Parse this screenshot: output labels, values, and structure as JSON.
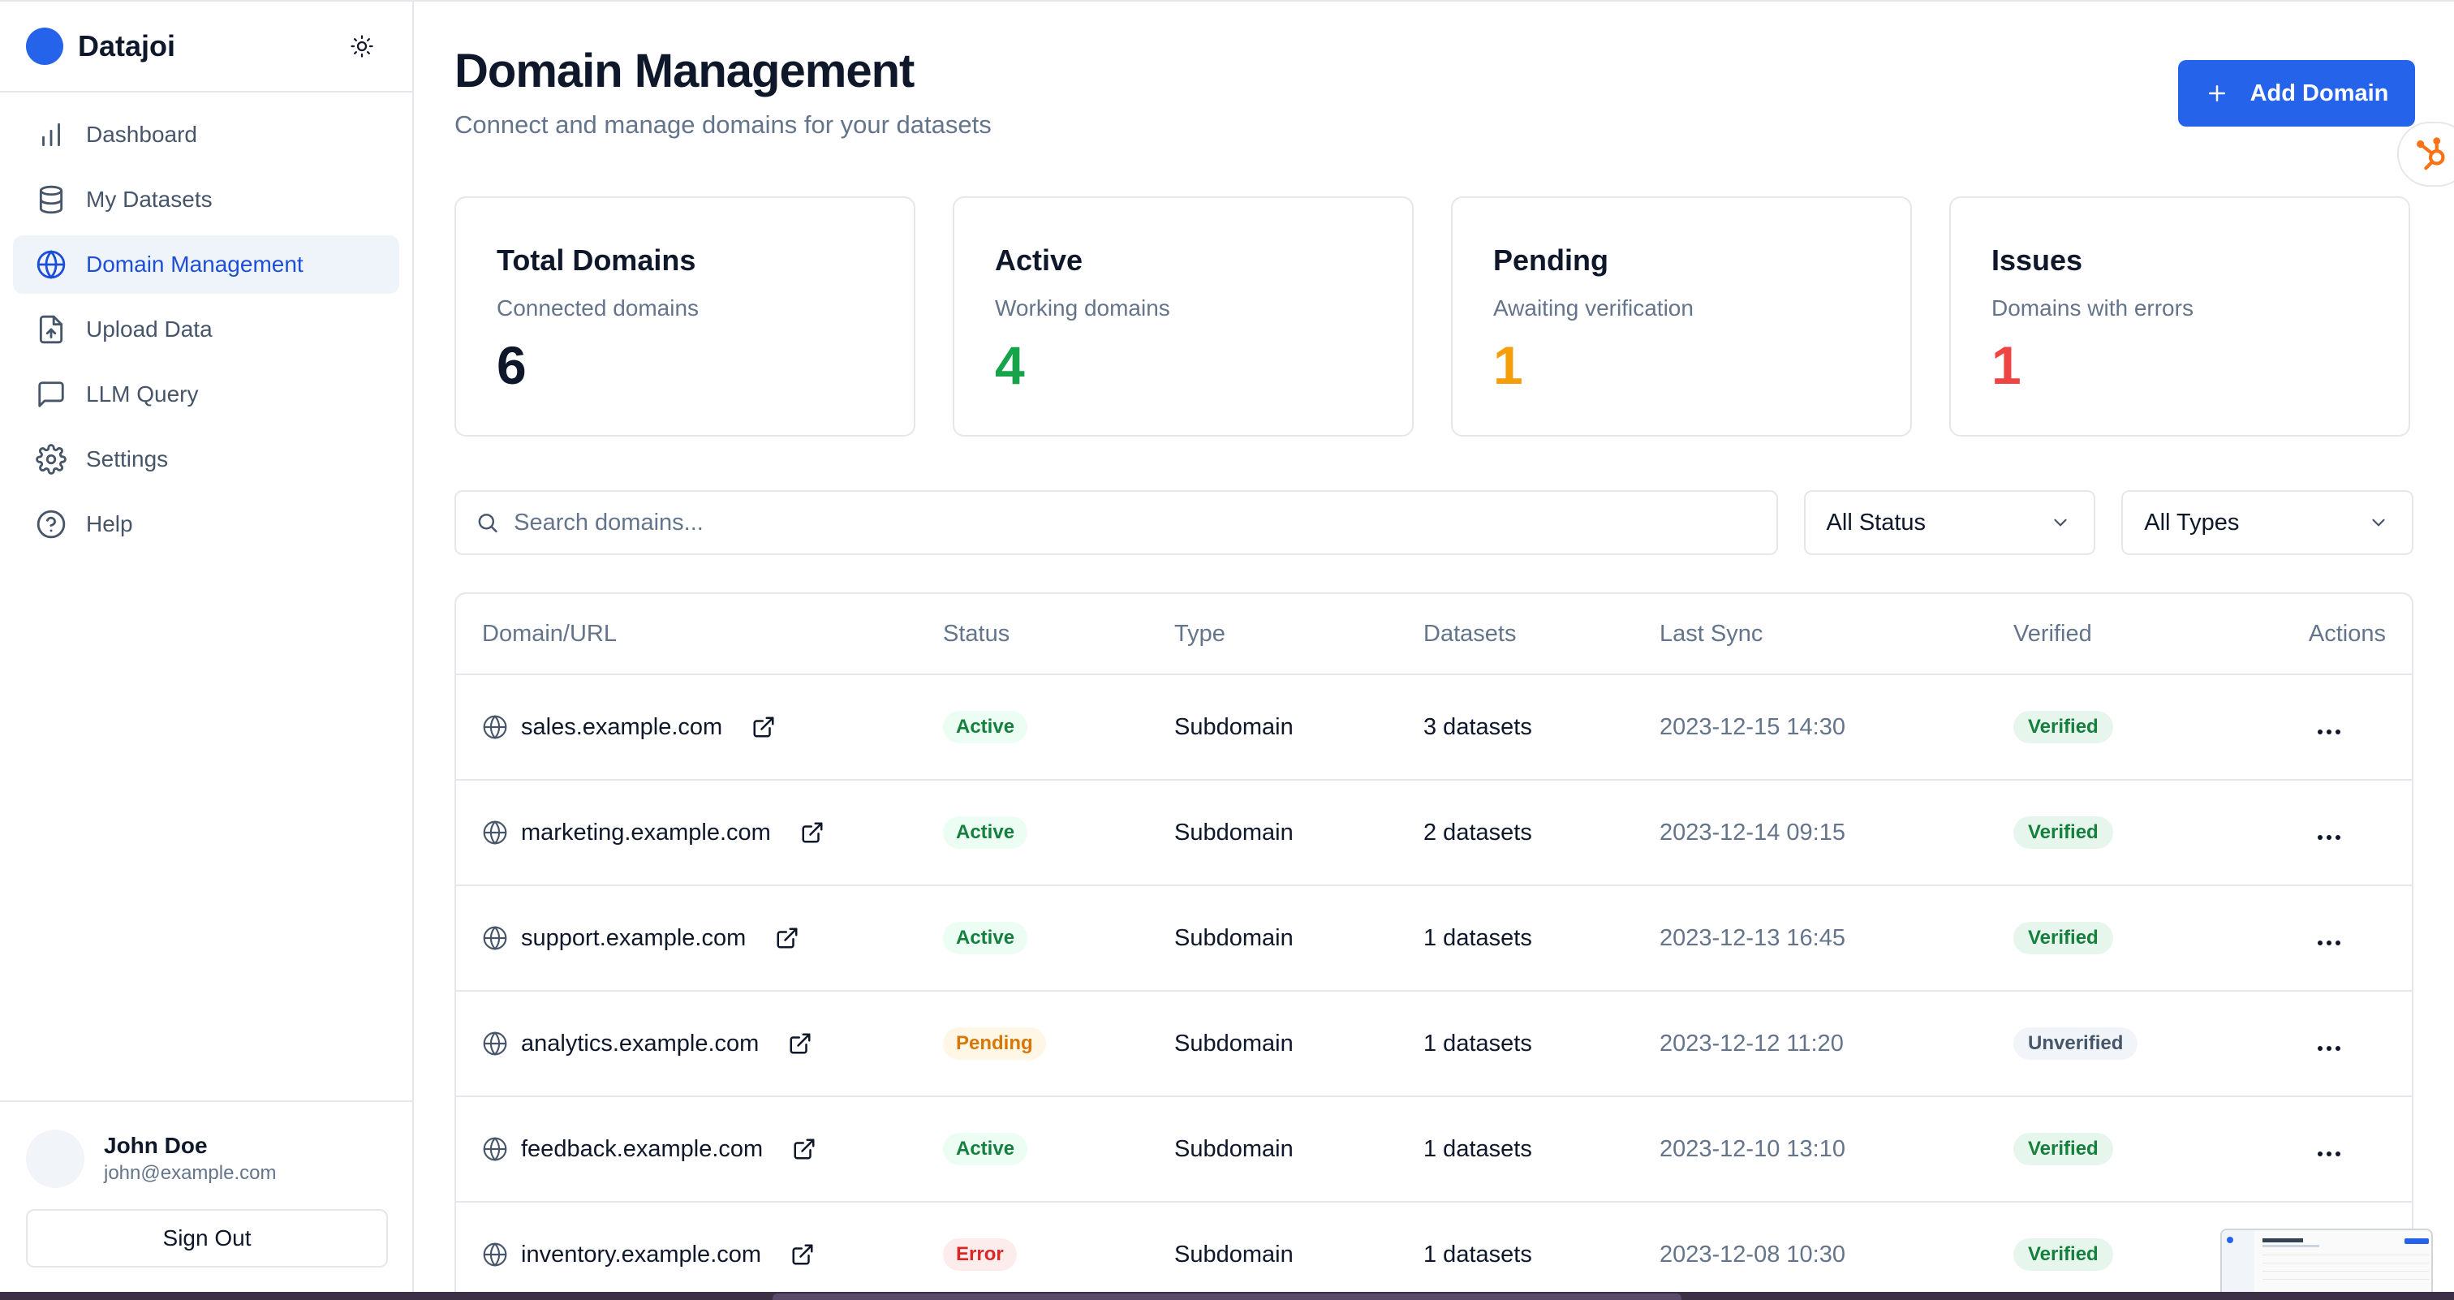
{
  "brand": {
    "name": "Datajoi",
    "color": "#2563eb"
  },
  "sidebar": {
    "items": [
      {
        "label": "Dashboard",
        "icon": "bar-chart-icon",
        "active": false
      },
      {
        "label": "My Datasets",
        "icon": "database-icon",
        "active": false
      },
      {
        "label": "Domain Management",
        "icon": "globe-icon",
        "active": true
      },
      {
        "label": "Upload Data",
        "icon": "file-upload-icon",
        "active": false
      },
      {
        "label": "LLM Query",
        "icon": "chat-icon",
        "active": false
      },
      {
        "label": "Settings",
        "icon": "gear-icon",
        "active": false
      },
      {
        "label": "Help",
        "icon": "help-circle-icon",
        "active": false
      }
    ],
    "user": {
      "name": "John Doe",
      "email": "john@example.com"
    },
    "signout_label": "Sign Out"
  },
  "header": {
    "title": "Domain Management",
    "subtitle": "Connect and manage domains for your datasets",
    "add_button_label": "Add Domain"
  },
  "stats": [
    {
      "title": "Total Domains",
      "subtitle": "Connected domains",
      "value": "6",
      "color": "#0f172a"
    },
    {
      "title": "Active",
      "subtitle": "Working domains",
      "value": "4",
      "color": "#16a34a"
    },
    {
      "title": "Pending",
      "subtitle": "Awaiting verification",
      "value": "1",
      "color": "#f59e0b"
    },
    {
      "title": "Issues",
      "subtitle": "Domains with errors",
      "value": "1",
      "color": "#ef4444"
    }
  ],
  "filters": {
    "search_placeholder": "Search domains...",
    "status_selected": "All Status",
    "type_selected": "All Types"
  },
  "table": {
    "columns": [
      "Domain/URL",
      "Status",
      "Type",
      "Datasets",
      "Last Sync",
      "Verified",
      "Actions"
    ],
    "rows": [
      {
        "domain": "sales.example.com",
        "status": "Active",
        "type": "Subdomain",
        "datasets": "3 datasets",
        "last_sync": "2023-12-15 14:30",
        "verified": "Verified"
      },
      {
        "domain": "marketing.example.com",
        "status": "Active",
        "type": "Subdomain",
        "datasets": "2 datasets",
        "last_sync": "2023-12-14 09:15",
        "verified": "Verified"
      },
      {
        "domain": "support.example.com",
        "status": "Active",
        "type": "Subdomain",
        "datasets": "1 datasets",
        "last_sync": "2023-12-13 16:45",
        "verified": "Verified"
      },
      {
        "domain": "analytics.example.com",
        "status": "Pending",
        "type": "Subdomain",
        "datasets": "1 datasets",
        "last_sync": "2023-12-12 11:20",
        "verified": "Unverified"
      },
      {
        "domain": "feedback.example.com",
        "status": "Active",
        "type": "Subdomain",
        "datasets": "1 datasets",
        "last_sync": "2023-12-10 13:10",
        "verified": "Verified"
      },
      {
        "domain": "inventory.example.com",
        "status": "Error",
        "type": "Subdomain",
        "datasets": "1 datasets",
        "last_sync": "2023-12-08 10:30",
        "verified": "Verified"
      }
    ]
  }
}
